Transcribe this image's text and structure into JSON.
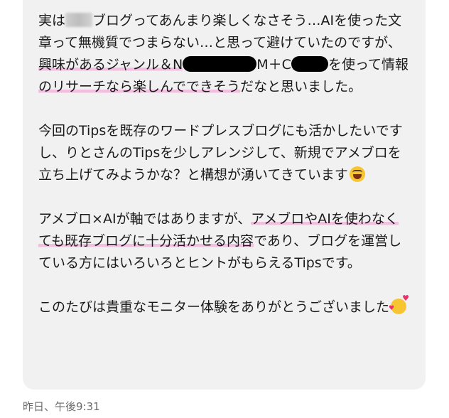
{
  "message": {
    "p1": {
      "a": "実は",
      "b": "ブログってあんまり楽しくなさそう…AIを使った文章って無機質でつまらない…と思って避けていたのですが、",
      "hl1": "興味があるジャンル＆N",
      "c": "M＋",
      "d": "C",
      "e": "を使って情報",
      "hl2": "のリサーチなら楽しんでできそう",
      "f": "だなと思いました。"
    },
    "p2": {
      "a": "今回のTipsを既存のワードプレスブログにも活かしたいですし、りとさんのTipsを少しアレンジして、新規でアメブロを立ち上げてみようかな？と構想が湧いてきています"
    },
    "p3": {
      "a": "アメブロ×AIが軸ではありますが、",
      "hl1": "アメブロやAIを使わなくても既存ブログに十分活かせる内容",
      "b": "であり、ブログを運営している方にはいろいろとヒントがもらえるTipsです。"
    },
    "p4": {
      "a": "このたびは貴重なモニター体験をありがとうございました"
    },
    "emojis": [
      "grinning-squinting-face",
      "smiling-face-with-hearts"
    ],
    "highlight_color": "#f3bfe0",
    "bubble_color": "#f1f1f1"
  },
  "timestamp": "昨日、午後9:31"
}
